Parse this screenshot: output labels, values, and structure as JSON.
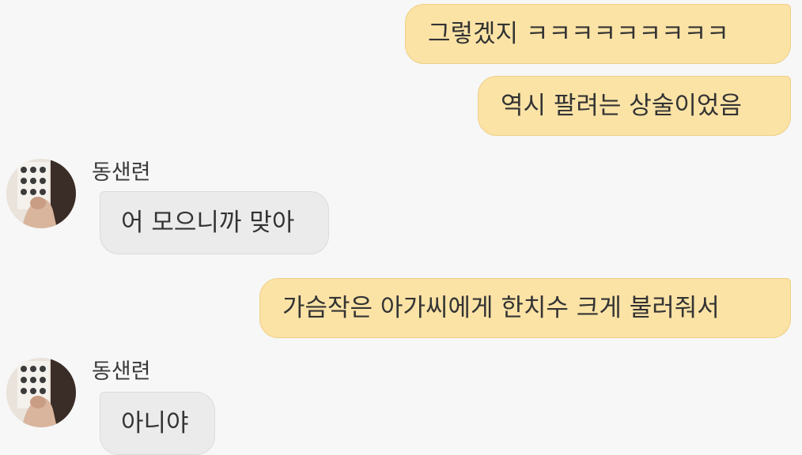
{
  "chat": {
    "messages": [
      {
        "side": "out",
        "text": "그렇겠지 ㅋㅋㅋㅋㅋㅋㅋㅋㅋ"
      },
      {
        "side": "out",
        "text": "역시 팔려는 상술이었음"
      },
      {
        "side": "in",
        "sender": "동샌련",
        "avatar_icon": "profile-photo",
        "text": "어 모으니까 맞아"
      },
      {
        "side": "out",
        "text": "가슴작은 아가씨에게 한치수 크게 불러줘서"
      },
      {
        "side": "in",
        "sender": "동샌련",
        "avatar_icon": "profile-photo",
        "text": "아니야"
      }
    ]
  },
  "colors": {
    "background": "#f7f7f7",
    "outgoing_bubble": "#fbe3a6",
    "incoming_bubble": "#ebebeb",
    "text": "#333333"
  }
}
